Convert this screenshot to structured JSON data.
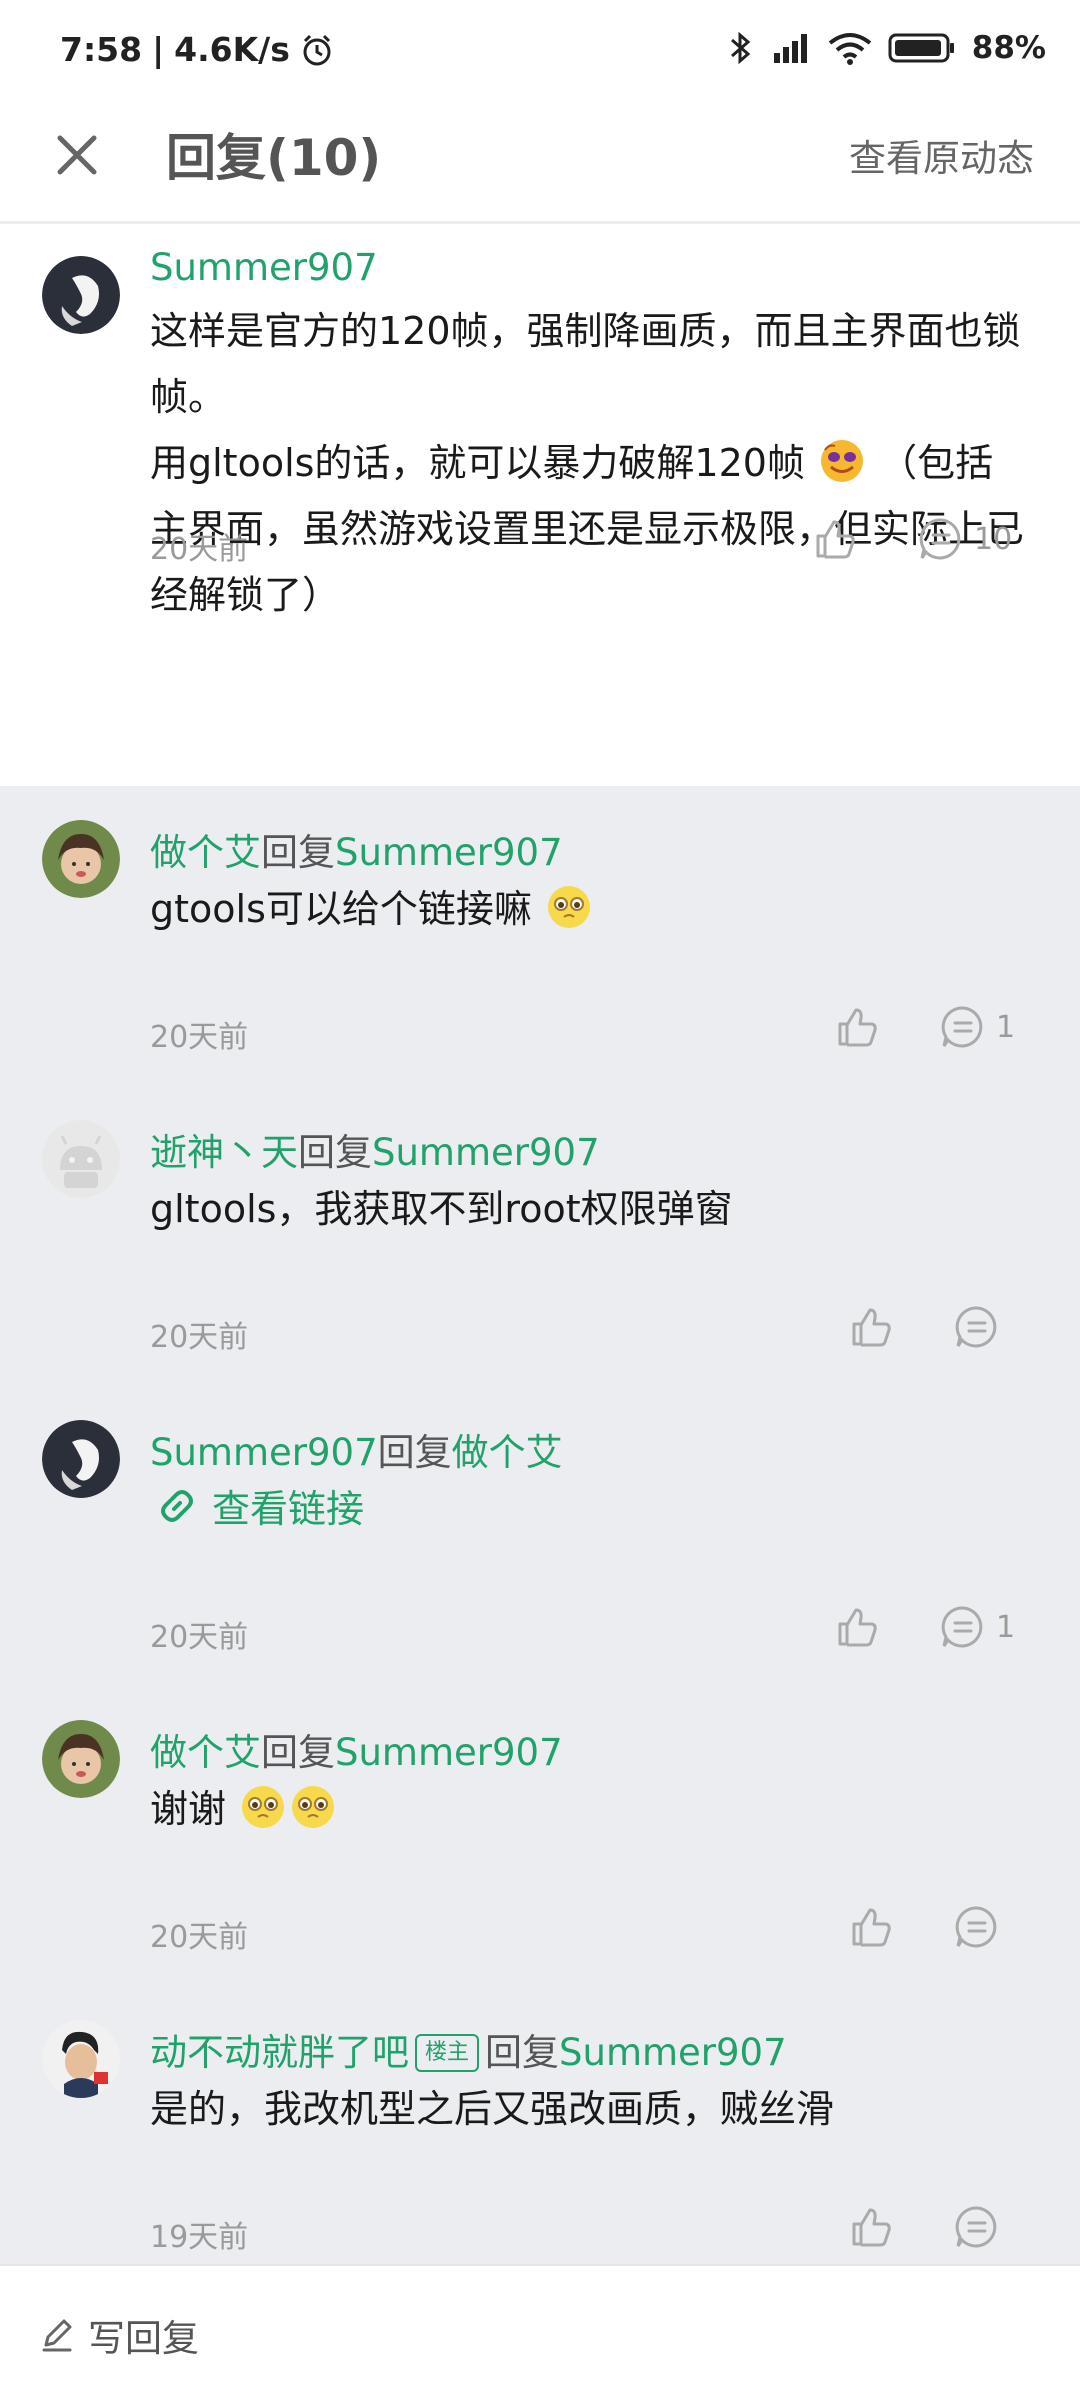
{
  "status_bar": {
    "time": "7:58",
    "speed": "4.6K/s",
    "battery": "88%"
  },
  "header": {
    "title": "回复(10)",
    "link": "查看原动态"
  },
  "main_comment": {
    "author": "Summer907",
    "text_line1": "这样是官方的120帧，强制降画质，而且主界面也锁帧。",
    "text_line2a": "用gltools的话，就可以暴力破解120帧",
    "text_line2b": "（包括主界面，虽然游戏设置里还是显示极限，但实际上已经解锁了）",
    "time": "20天前",
    "reply_count": "10"
  },
  "replies": [
    {
      "author": "做个艾",
      "reply_word": "回复",
      "target": "Summer907",
      "text": "gtools可以给个链接嘛",
      "time": "20天前",
      "reply_count": "1"
    },
    {
      "author": "逝神丶天",
      "reply_word": "回复",
      "target": "Summer907",
      "text": "gltools，我获取不到root权限弹窗",
      "time": "20天前",
      "reply_count": ""
    },
    {
      "author": "Summer907",
      "reply_word": "回复",
      "target": "做个艾",
      "link_text": "查看链接",
      "time": "20天前",
      "reply_count": "1"
    },
    {
      "author": "做个艾",
      "reply_word": "回复",
      "target": "Summer907",
      "text": "谢谢 ",
      "time": "20天前",
      "reply_count": ""
    },
    {
      "author": "动不动就胖了吧",
      "badge": "楼主",
      "reply_word": "回复",
      "target": "Summer907",
      "text": "是的，我改机型之后又强改画质，贼丝滑",
      "time": "19天前",
      "reply_count": ""
    }
  ],
  "footer": {
    "write_reply": "写回复"
  },
  "colors": {
    "accent": "#20a26a",
    "muted": "#9a9a9a",
    "reply_bg": "#ecedf1"
  }
}
